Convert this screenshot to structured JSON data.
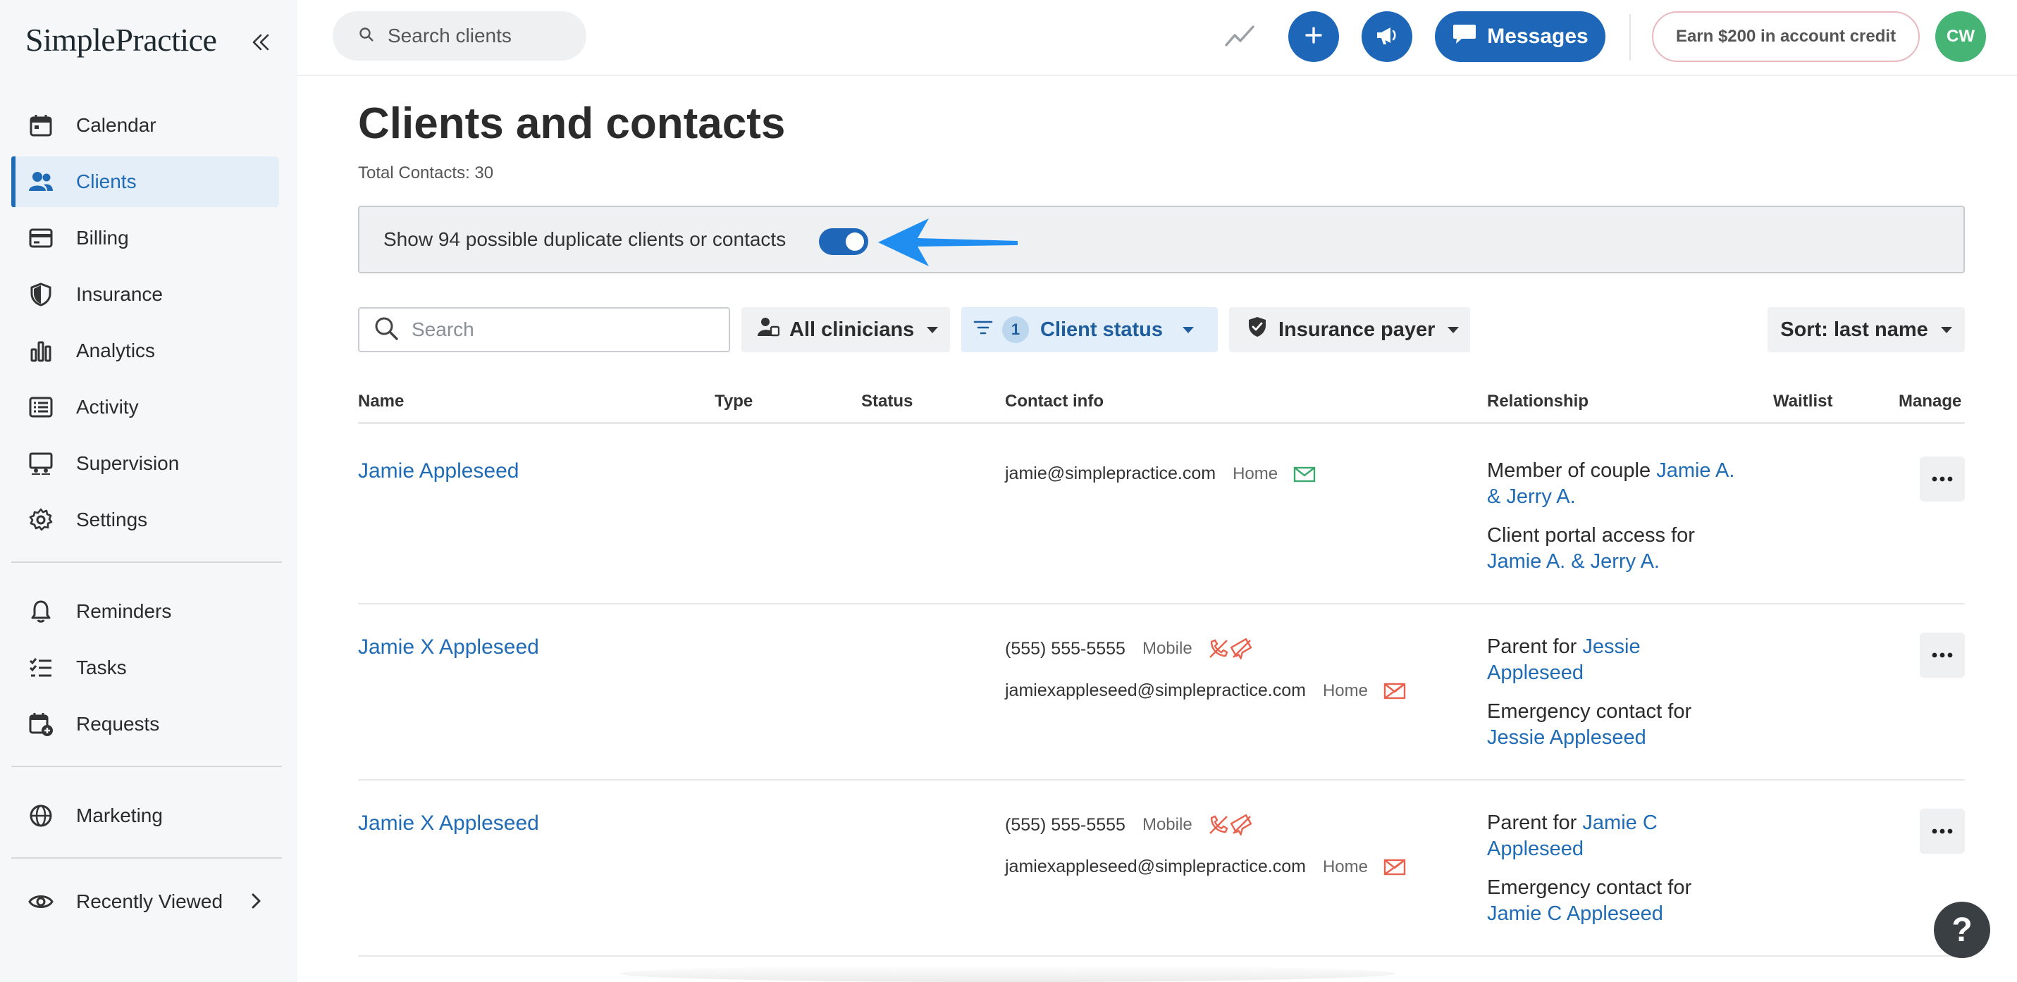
{
  "app": {
    "logo": "SimplePractice"
  },
  "sidebar": {
    "items": [
      {
        "label": "Calendar",
        "icon": "calendar-icon"
      },
      {
        "label": "Clients",
        "icon": "users-icon",
        "active": true
      },
      {
        "label": "Billing",
        "icon": "credit-card-icon"
      },
      {
        "label": "Insurance",
        "icon": "shield-icon"
      },
      {
        "label": "Analytics",
        "icon": "bar-chart-icon"
      },
      {
        "label": "Activity",
        "icon": "list-icon"
      },
      {
        "label": "Supervision",
        "icon": "supervision-icon"
      },
      {
        "label": "Settings",
        "icon": "gear-icon"
      },
      {
        "label": "Reminders",
        "icon": "bell-icon"
      },
      {
        "label": "Tasks",
        "icon": "tasks-icon"
      },
      {
        "label": "Requests",
        "icon": "calendar-plus-icon"
      },
      {
        "label": "Marketing",
        "icon": "globe-icon"
      },
      {
        "label": "Recently Viewed",
        "icon": "eye-icon"
      }
    ]
  },
  "topbar": {
    "search_placeholder": "Search clients",
    "messages_label": "Messages",
    "earn_label": "Earn $200 in account credit",
    "avatar_initials": "CW"
  },
  "main": {
    "title": "Clients and contacts",
    "total_contacts": "Total Contacts: 30",
    "duplicate_text": "Show 94 possible duplicate clients or contacts",
    "duplicate_toggle_on": true,
    "filters": {
      "search_placeholder": "Search",
      "clinicians": "All clinicians",
      "status_count": "1",
      "status": "Client status",
      "insurance": "Insurance payer",
      "sort": "Sort: last name"
    },
    "columns": [
      "Name",
      "Type",
      "Status",
      "Contact info",
      "Relationship",
      "Waitlist",
      "Manage"
    ],
    "rows": [
      {
        "name": "Jamie Appleseed",
        "contacts": [
          {
            "value": "jamie@simplepractice.com",
            "tag": "Home",
            "icon": "email-icon"
          }
        ],
        "relationships": [
          {
            "text": "Member of couple",
            "link": "Jamie A. & Jerry A."
          },
          {
            "text": "Client portal access for",
            "link": "Jamie A. & Jerry A."
          }
        ]
      },
      {
        "name": "Jamie X Appleseed",
        "contacts": [
          {
            "value": "(555) 555-5555",
            "tag": "Mobile",
            "icon": "no-call-no-text-icon"
          },
          {
            "value": "jamiexappleseed@simplepractice.com",
            "tag": "Home",
            "icon": "no-email-icon"
          }
        ],
        "relationships": [
          {
            "text": "Parent for",
            "link": "Jessie Appleseed"
          },
          {
            "text": "Emergency contact for",
            "link": "Jessie Appleseed"
          }
        ]
      },
      {
        "name": "Jamie X Appleseed",
        "contacts": [
          {
            "value": "(555) 555-5555",
            "tag": "Mobile",
            "icon": "no-call-no-text-icon"
          },
          {
            "value": "jamiexappleseed@simplepractice.com",
            "tag": "Home",
            "icon": "no-email-icon"
          }
        ],
        "relationships": [
          {
            "text": "Parent for",
            "link": "Jamie C Appleseed"
          },
          {
            "text": "Emergency contact for",
            "link": "Jamie C Appleseed"
          }
        ]
      }
    ]
  },
  "help_label": "?",
  "colors": {
    "accent": "#1e66b8",
    "link": "#1f6bb5",
    "avatar": "#45b474",
    "warning_icon": "#e8614d",
    "email_ok": "#3aa76d"
  }
}
